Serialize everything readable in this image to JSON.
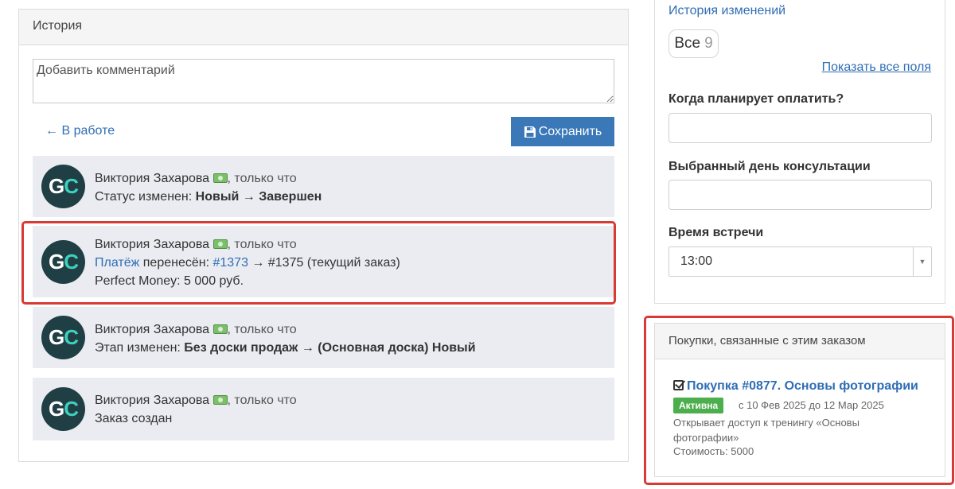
{
  "history": {
    "title": "История",
    "comment_placeholder": "Добавить комментарий",
    "back_label": "← В работе",
    "save_label": "Сохранить",
    "entries": [
      {
        "author": "Виктория Захарова",
        "time": ", только что",
        "avatar": "GC",
        "prefix": "Статус изменен: ",
        "from": "Новый",
        "arrow": " → ",
        "to": "Завершен"
      },
      {
        "author": "Виктория Захарова",
        "time": ", только что",
        "avatar": "GC",
        "link1": "Платёж",
        "text1": " перенесён: ",
        "link2": "#1373",
        "text2": " → #1375 (текущий заказ)",
        "line3": "Perfect Money: 5 000 руб."
      },
      {
        "author": "Виктория Захарова",
        "time": ", только что",
        "avatar": "GC",
        "prefix": "Этап изменен: ",
        "from": "Без доски продаж",
        "arrow": " → ",
        "to": "(Основная доска) Новый"
      },
      {
        "author": "Виктория Захарова",
        "time": ", только что",
        "avatar": "GC",
        "text": "Заказ создан"
      }
    ]
  },
  "sidebar": {
    "history_link": "История изменений",
    "chip_label": "Все",
    "chip_count": "9",
    "show_all": "Показать все поля",
    "fields": [
      {
        "label": "Когда планирует оплатить?",
        "value": ""
      },
      {
        "label": "Выбранный день консультации",
        "value": ""
      },
      {
        "label": "Время встречи",
        "value": "13:00"
      }
    ]
  },
  "purchases": {
    "title": "Покупки, связанные с этим заказом",
    "item_title": "Покупка #0877. Основы фотографии",
    "status": "Активна",
    "dates": "с 10 Фев 2025 до 12 Мар 2025",
    "description": "Открывает доступ к тренингу «Основы фотографии»",
    "cost": "Стоимость: 5000"
  },
  "colors": {
    "link": "#2f6db5",
    "save_button": "#3a78b8",
    "highlight": "#d83a35",
    "badge": "#4cae4c"
  }
}
